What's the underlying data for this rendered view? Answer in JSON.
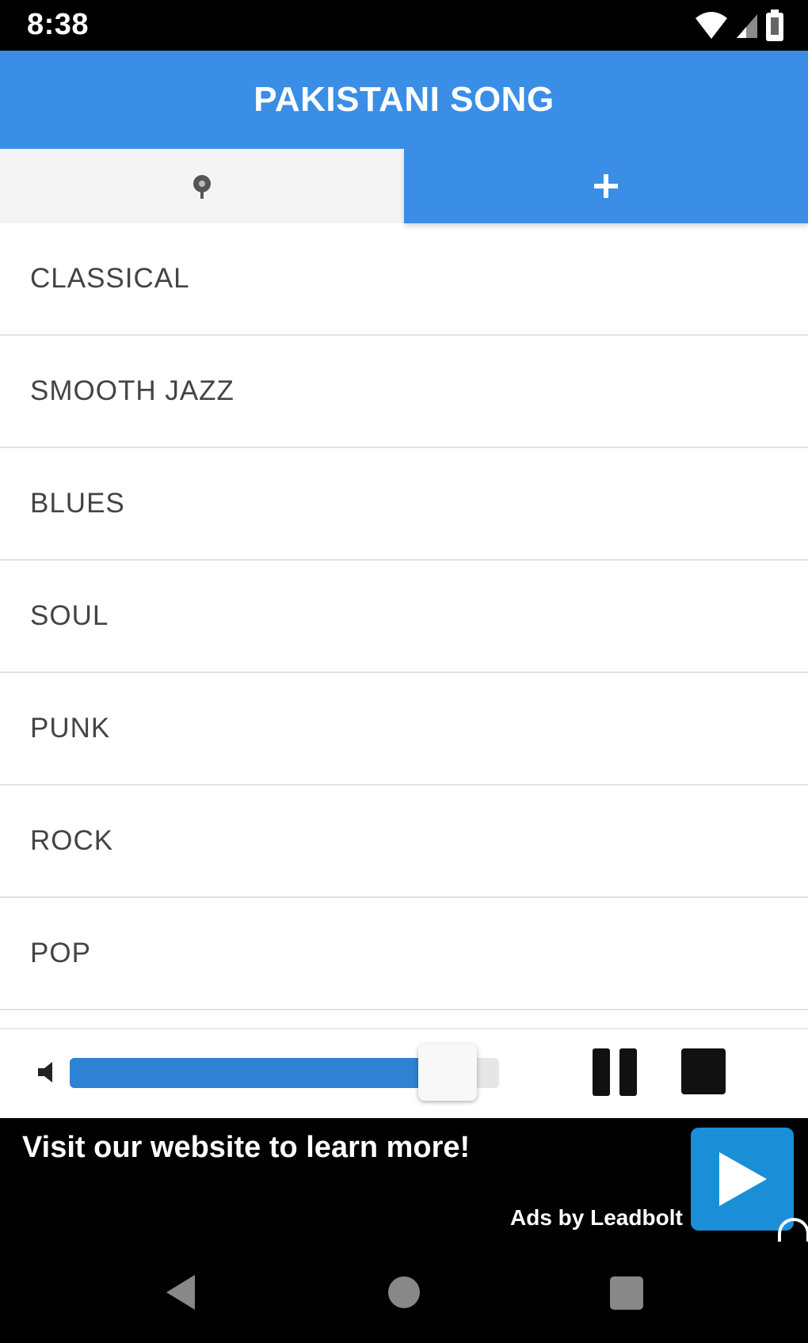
{
  "status_bar": {
    "time": "8:38",
    "icons": [
      "wifi-icon",
      "signal-icon",
      "battery-icon"
    ]
  },
  "app_bar": {
    "title": "PAKISTANI SONG",
    "color": "#3a8ee6"
  },
  "tabs": [
    {
      "icon": "radio-icon",
      "selected": false
    },
    {
      "label": "+",
      "icon": "plus-icon",
      "selected": true
    }
  ],
  "genres": [
    {
      "label": "CLASSICAL"
    },
    {
      "label": "SMOOTH JAZZ"
    },
    {
      "label": "BLUES"
    },
    {
      "label": "SOUL"
    },
    {
      "label": "PUNK"
    },
    {
      "label": "ROCK"
    },
    {
      "label": "POP"
    }
  ],
  "player": {
    "volume_fraction": 0.86,
    "controls": [
      "pause-icon",
      "stop-icon"
    ],
    "accent": "#2f82d3"
  },
  "ad": {
    "text": "Visit our website to learn more!",
    "credit": "Ads by Leadbolt",
    "button_color": "#1a8fd8"
  },
  "nav_bar": {
    "icons": [
      "back-icon",
      "home-icon",
      "recents-icon"
    ]
  }
}
